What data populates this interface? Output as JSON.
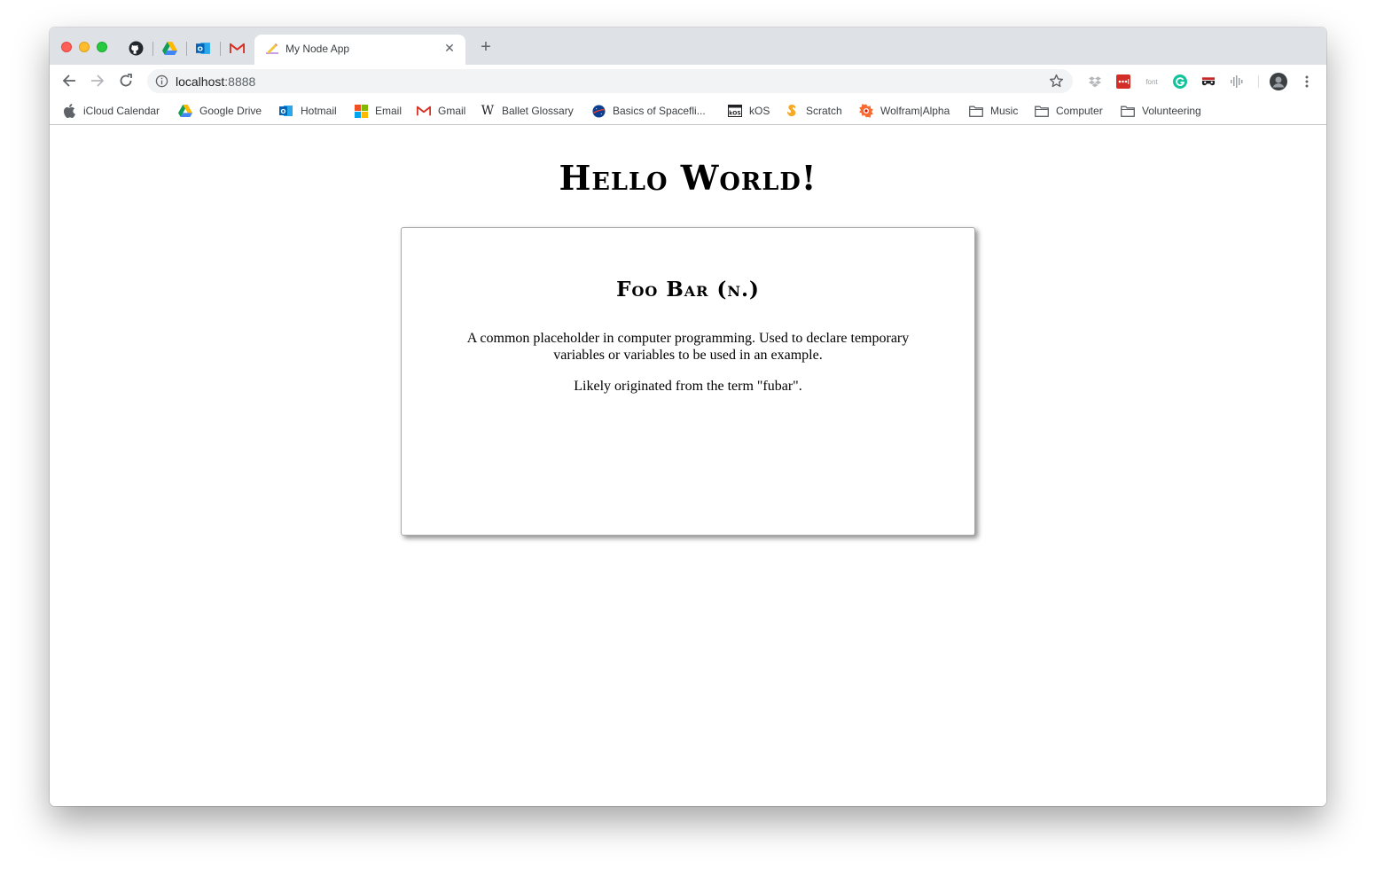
{
  "browser": {
    "active_tab": {
      "title": "My Node App"
    },
    "omnibox": {
      "host": "localhost",
      "port": ":8888"
    },
    "bookmarks": [
      {
        "label": "iCloud Calendar",
        "icon": "apple-icon"
      },
      {
        "label": "Google Drive",
        "icon": "google-drive-icon"
      },
      {
        "label": "Hotmail",
        "icon": "outlook-icon"
      },
      {
        "label": "Email",
        "icon": "microsoft-icon"
      },
      {
        "label": "Gmail",
        "icon": "gmail-icon"
      },
      {
        "label": "Ballet Glossary",
        "icon": "wikipedia-icon"
      },
      {
        "label": "Basics of Spacefli...",
        "icon": "nasa-icon"
      },
      {
        "label": "kOS",
        "icon": "kos-icon"
      },
      {
        "label": "Scratch",
        "icon": "scratch-icon"
      },
      {
        "label": "Wolfram|Alpha",
        "icon": "wolfram-icon"
      },
      {
        "label": "Music",
        "icon": "folder-icon"
      },
      {
        "label": "Computer",
        "icon": "folder-icon"
      },
      {
        "label": "Volunteering",
        "icon": "folder-icon"
      }
    ],
    "extensions": {
      "font_label": "font"
    }
  },
  "page": {
    "title": "Hello World!",
    "card": {
      "title": "Foo Bar (n.)",
      "paragraphs": [
        "A common placeholder in computer programming. Used to declare temporary variables or variables to be used in an example.",
        "Likely originated from the term \"fubar\"."
      ]
    }
  },
  "colors": {
    "tabstrip": "#dee1e6",
    "omnibox": "#f1f3f4",
    "close_red": "#fe5f57",
    "minimize_yellow": "#febc2e",
    "zoom_green": "#28c840"
  }
}
